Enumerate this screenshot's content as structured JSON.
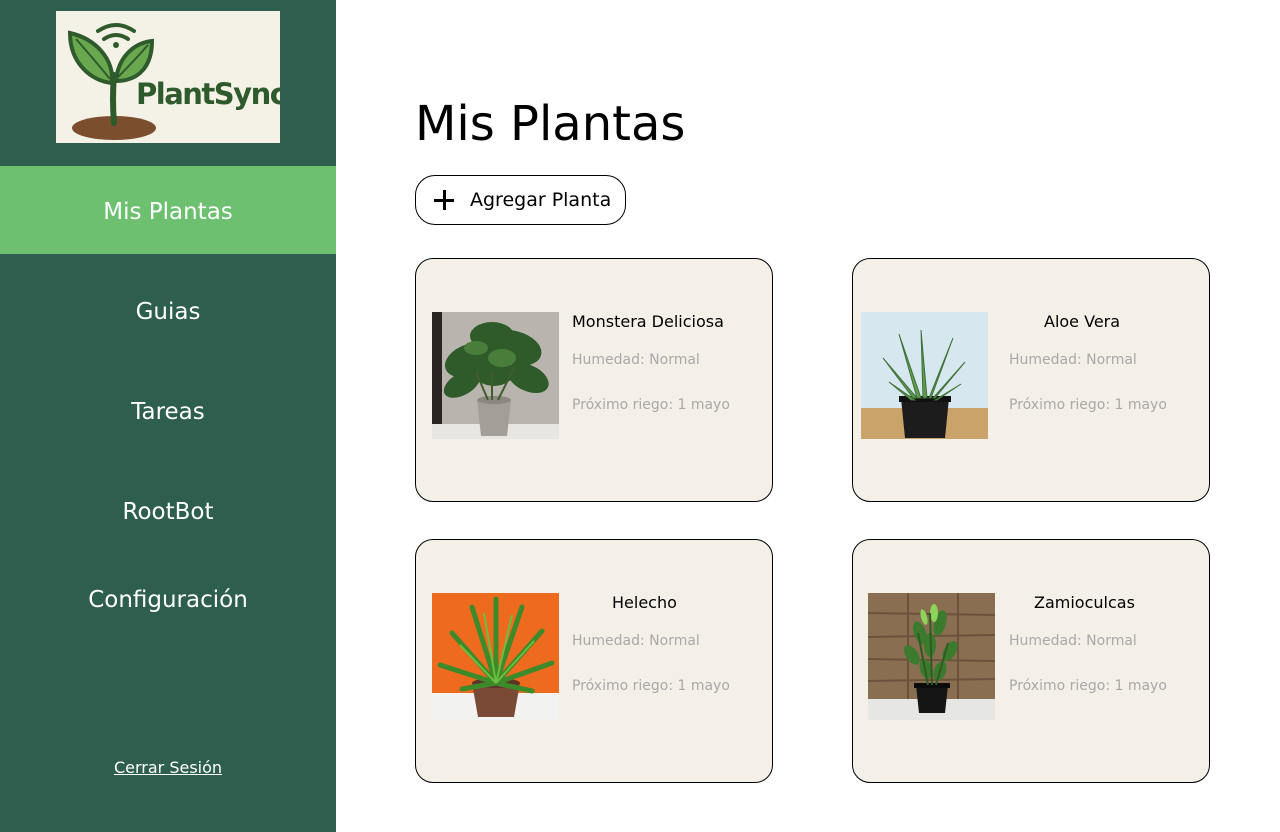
{
  "app": {
    "logo_text": "PlantSync"
  },
  "sidebar": {
    "items": [
      {
        "label": "Mis Plantas"
      },
      {
        "label": "Guias"
      },
      {
        "label": "Tareas"
      },
      {
        "label": "RootBot"
      },
      {
        "label": "Configuración"
      }
    ],
    "active_index": 0,
    "logout_label": "Cerrar Sesión"
  },
  "main": {
    "title": "Mis Plantas",
    "add_button_label": "Agregar Planta"
  },
  "plants": [
    {
      "name": "Monstera Deliciosa",
      "humidity": "Humedad: Normal",
      "next_watering": "Próximo riego: 1 mayo"
    },
    {
      "name": "Aloe Vera",
      "humidity": "Humedad: Normal",
      "next_watering": "Próximo riego: 1 mayo"
    },
    {
      "name": "Helecho",
      "humidity": "Humedad: Normal",
      "next_watering": "Próximo riego: 1 mayo"
    },
    {
      "name": "Zamioculcas",
      "humidity": "Humedad: Normal",
      "next_watering": "Próximo riego: 1 mayo"
    }
  ],
  "colors": {
    "sidebar_bg": "#2e5e4e",
    "active_item_bg": "#6cc070",
    "card_bg": "#f4f0e8",
    "muted_text": "#a8a8a8"
  }
}
